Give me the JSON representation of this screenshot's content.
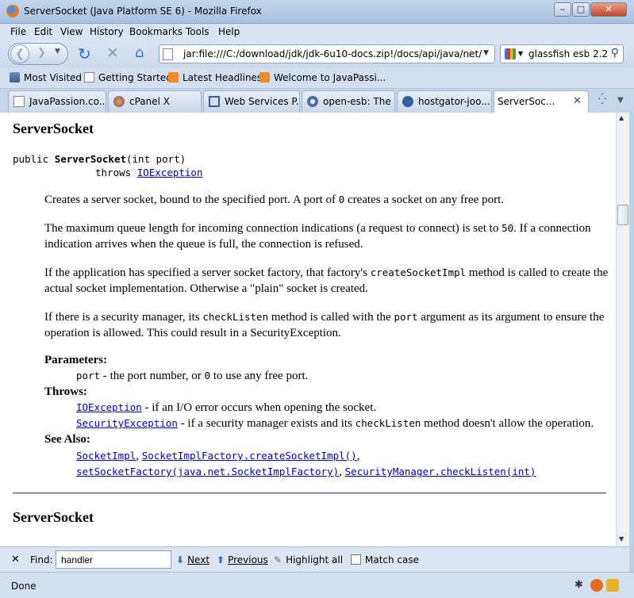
{
  "window": {
    "title": "ServerSocket (Java Platform SE 6) - Mozilla Firefox",
    "controls": {
      "minimize": "‒",
      "maximize": "□",
      "close": "✕"
    }
  },
  "menu": {
    "file": "File",
    "edit": "Edit",
    "view": "View",
    "history": "History",
    "bookmarks": "Bookmarks",
    "tools": "Tools",
    "help": "Help"
  },
  "nav": {
    "url": "jar:file:///C:/download/jdk/jdk-6u10-docs.zip!/docs/api/java/net/",
    "search_value": "glassfish esb 2.2",
    "icons": [
      "back-icon",
      "forward-icon",
      "reload-icon",
      "stop-icon",
      "home-icon",
      "bookmark-star-icon",
      "search-icon"
    ]
  },
  "bookmarks_bar": {
    "items": [
      "Most Visited",
      "Getting Started",
      "Latest Headlines",
      "Welcome to JavaPassi..."
    ]
  },
  "tabs": {
    "items": [
      "JavaPassion.co...",
      "cPanel X",
      "Web Services P...",
      "open-esb: The ...",
      "hostgator-joo...",
      "ServerSoc..."
    ],
    "active_index": 5
  },
  "doc": {
    "heading": "ServerSocket",
    "signature": {
      "prefix": "public ",
      "name": "ServerSocket",
      "params": "(int port)",
      "throws_kw": "throws ",
      "throws_link": "IOException"
    },
    "p1": {
      "a": "Creates a server socket, bound to the specified port. A port of ",
      "code": "0",
      "b": " creates a socket on any free port."
    },
    "p2": {
      "a": "The maximum queue length for incoming connection indications (a request to connect) is set to ",
      "code": "50",
      "b": ". If a connection indication arrives when the queue is full, the connection is refused."
    },
    "p3": {
      "a": "If the application has specified a server socket factory, that factory's ",
      "code": "createSocketImpl",
      "b": " method is called to create the actual socket implementation. Otherwise a \"plain\" socket is created."
    },
    "p4": {
      "a": "If there is a security manager, its ",
      "code1": "checkListen",
      "b": " method is called with the ",
      "code2": "port",
      "c": " argument as its argument to ensure the operation is allowed. This could result in a SecurityException."
    },
    "parameters_label": "Parameters:",
    "param": {
      "code": "port",
      "text": " - the port number, or ",
      "code2": "0",
      "text2": " to use any free port."
    },
    "throws_label": "Throws:",
    "throw1": {
      "link": "IOException",
      "text": " - if an I/O error occurs when opening the socket."
    },
    "throw2": {
      "link": "SecurityException",
      "text": " - if a security manager exists and its ",
      "code": "checkListen",
      "text2": " method doesn't allow the operation."
    },
    "see_also_label": "See Also:",
    "see1": {
      "l1": "SocketImpl",
      "sep1": ", ",
      "l2": "SocketImplFactory.createSocketImpl()",
      "sep2": ","
    },
    "see2": {
      "l1": "setSocketFactory(java.net.SocketImplFactory)",
      "sep1": ", ",
      "l2": "SecurityManager.checkListen(int)"
    },
    "heading2": "ServerSocket"
  },
  "findbar": {
    "close": "✕",
    "label": "Find:",
    "value": "handler",
    "next": "Next",
    "previous": "Previous",
    "highlight": "Highlight all",
    "match_case": "Match case"
  },
  "status": {
    "text": "Done"
  }
}
